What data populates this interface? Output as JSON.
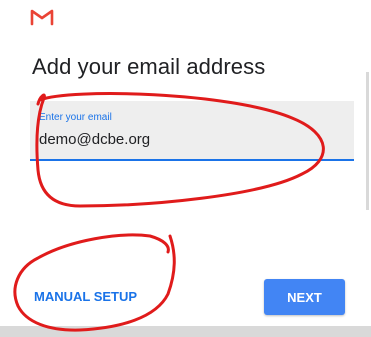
{
  "app": {
    "logo_icon": "gmail-m-icon",
    "logo_color": "#ea4335"
  },
  "header": {
    "title": "Add your email address"
  },
  "email_field": {
    "label": "Enter your email",
    "value": "demo@dcbe.org",
    "accent_color": "#1a73e8"
  },
  "actions": {
    "manual_setup_label": "MANUAL SETUP",
    "next_label": "NEXT",
    "next_color": "#4285f4"
  },
  "annotations": {
    "color": "#e01b1b",
    "shapes": [
      "email-field-circle",
      "manual-setup-circle"
    ]
  }
}
